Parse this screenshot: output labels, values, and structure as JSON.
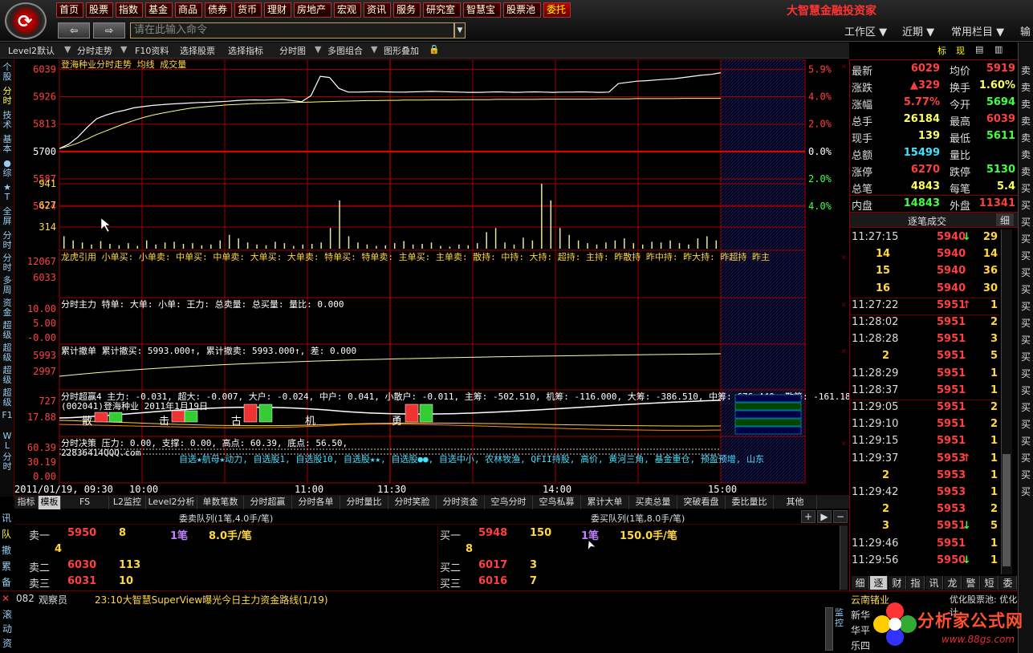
{
  "nav": {
    "items": [
      "首页",
      "股票",
      "指数",
      "基金",
      "商品",
      "债券",
      "货币",
      "理财",
      "房地产",
      "宏观",
      "资讯",
      "服务",
      "研究室",
      "智慧宝",
      "股票池",
      "委托"
    ],
    "selected": "委托",
    "brand": "大智慧金融投资家"
  },
  "command": {
    "placeholder": "请在此输入命令",
    "back": "⇦",
    "forward": "⇨"
  },
  "topright": {
    "workspace": "工作区 ▼",
    "recent": "近期 ▼",
    "common": "常用栏目 ▼",
    "extra": "输"
  },
  "toolbar": {
    "items": [
      "Level2默认",
      "分时走势",
      "F10资料",
      "选择股票",
      "选择指标",
      "分时图",
      "多图组合",
      "图形叠加"
    ],
    "right_items": [
      "标",
      "现"
    ]
  },
  "leftbar": {
    "items": [
      "个股",
      "分时",
      "技术",
      "基本",
      "●综",
      "★T",
      "全屏",
      "分时",
      "分时",
      "多周",
      "资金",
      "超级",
      "超级",
      "超级",
      "超级",
      "F1",
      "WL",
      "分时"
    ]
  },
  "chart": {
    "title": "登海种业分时走势  均线  成交量",
    "price_ticks": [
      "6039",
      "5926",
      "5813",
      "5700",
      "5587",
      "5474"
    ],
    "pct_ticks": [
      "5.9%",
      "4.0%",
      "2.0%",
      "0.0%",
      "2.0%",
      "4.0%"
    ],
    "vol_ticks": [
      "941",
      "627",
      "314"
    ],
    "indicator1": {
      "label": "龙虎引用  小单买: 小单卖: 中单买: 中单卖: 大单买: 大单卖: 特单买: 特单卖: 主单买: 主单卖: 散持: 中持: 大持: 超持: 主持: 昨散持  昨中持: 昨大持: 昨超持  昨主",
      "ticks": [
        "12067",
        "6033"
      ]
    },
    "indicator2": {
      "label": "分时主力  特单: 大单: 小单: 王力: 总卖量: 总买量: 量比: 0.000",
      "ticks": [
        "10.00",
        "5.00",
        "-0.00"
      ]
    },
    "indicator3": {
      "label": "累计撤单  累计撤买: 5993.000↑, 累计撤卖: 5993.000↑, 差: 0.000",
      "ticks": [
        "5993",
        "2997"
      ]
    },
    "indicator4": {
      "label": "分时超赢4  主力: -0.031, 超大: -0.007, 大户: -0.024, 中户: 0.041, 小散户: -0.011, 主筹: -502.510, 机筹: -116.000, 大筹: -386.510, 中筹: 676.440, 散筹: -161.180,",
      "sub": "(002041)登海种业  2011年1月19日",
      "ticks": [
        "727",
        "17.88"
      ],
      "overlay": [
        "散",
        "击",
        "古",
        "机",
        "勇"
      ]
    },
    "indicator5": {
      "label": "分时决策  压力: 0.00, 支撑: 0.00, 高点: 60.39, 底点: 56.50,",
      "sub": "22836414QQQ.com",
      "ticks": [
        "60.39",
        "30.19",
        "0.00"
      ]
    },
    "notice": "自选★航母★动力, 自选股1, 自选股10, 自选股★★, 自选股●●, 自选中小, 农林牧渔, QFII持股, 高价, 黄河三角, 基金重仓, 预盈预增, 山东",
    "time_ticks": [
      "2011/01/19, 09:30",
      "10:00",
      "11:00",
      "11:30",
      "14:00",
      "15:00"
    ],
    "price_series": [
      5712,
      5730,
      5760,
      5800,
      5835,
      5850,
      5862,
      5870,
      5880,
      5885,
      5890,
      5893,
      5896,
      5898,
      5900,
      5902,
      5903,
      5905,
      5907,
      5910,
      5912,
      5913,
      5912,
      5914,
      5915,
      5910,
      5905,
      5930,
      6010,
      6005,
      5960,
      5945,
      5945,
      5946,
      5947,
      5946,
      5945,
      5945,
      5946,
      5947,
      5948,
      5947,
      5946,
      5945,
      5944,
      5944,
      5945,
      5946,
      5945,
      5944,
      5945,
      5946,
      5945,
      5944,
      5945,
      5945,
      5946,
      5945,
      5944,
      5945,
      5980,
      5985,
      5990,
      5992,
      5995,
      5998,
      6000,
      6005,
      6010,
      6015,
      6018,
      6025
    ],
    "avg_series": [
      5712,
      5722,
      5735,
      5752,
      5770,
      5785,
      5800,
      5815,
      5828,
      5840,
      5850,
      5858,
      5865,
      5872,
      5878,
      5882,
      5886,
      5889,
      5892,
      5894,
      5896,
      5898,
      5899,
      5900,
      5901,
      5902,
      5903,
      5904,
      5905,
      5906,
      5907,
      5908,
      5909,
      5910,
      5910,
      5911,
      5911,
      5912,
      5912,
      5912,
      5913,
      5913,
      5913,
      5914,
      5914,
      5914,
      5914,
      5915,
      5915,
      5915,
      5915,
      5915,
      5916,
      5916,
      5916,
      5916,
      5916,
      5916,
      5917,
      5917,
      5917,
      5917,
      5918,
      5918,
      5918,
      5918,
      5918,
      5919,
      5919,
      5919,
      5919,
      5919
    ],
    "volume_series": [
      180,
      120,
      90,
      60,
      110,
      70,
      50,
      80,
      40,
      120,
      60,
      90,
      100,
      70,
      80,
      50,
      60,
      120,
      200,
      150,
      90,
      60,
      50,
      100,
      80,
      40,
      60,
      70,
      90,
      300,
      700,
      180,
      90,
      60,
      40,
      50,
      80,
      110,
      60,
      70,
      90,
      40,
      30,
      60,
      50,
      80,
      240,
      300,
      90,
      60,
      160,
      120,
      941,
      700,
      300,
      200,
      120,
      80,
      60,
      90,
      120,
      150,
      80,
      60,
      100,
      90,
      120,
      80,
      60,
      150,
      180,
      120
    ]
  },
  "bottom_tabs": {
    "items": [
      "指标",
      "模板",
      "FS",
      "L2监控",
      "Level2分析",
      "单数笔数",
      "分时超赢",
      "分时各单",
      "分时量比",
      "分时笑脸",
      "分时资金",
      "空鸟分时",
      "空鸟私募",
      "累计大单",
      "买卖总量",
      "突破看盘",
      "委比量比",
      "其他"
    ],
    "selected": "模板"
  },
  "queue": {
    "sell_title": "委卖队列(1笔,4.0手/笔)",
    "buy_title": "委买队列(1笔,8.0手/笔)",
    "side_tabs": [
      "讯",
      "队",
      "撤",
      "累",
      "备"
    ],
    "sell_rows": [
      {
        "label": "卖一",
        "price": "5950",
        "vol": "8",
        "count": "1笔",
        "avg": "8.0手/笔"
      },
      {
        "label": "",
        "price": "",
        "vol": "4",
        "count": "",
        "avg": ""
      },
      {
        "label": "卖二",
        "price": "6030",
        "vol": "113",
        "count": "",
        "avg": ""
      },
      {
        "label": "卖三",
        "price": "6031",
        "vol": "10",
        "count": "",
        "avg": ""
      }
    ],
    "buy_rows": [
      {
        "label": "买一",
        "price": "5948",
        "vol": "150",
        "count": "1笔",
        "avg": "150.0手/笔"
      },
      {
        "label": "",
        "price": "",
        "vol": "8",
        "count": "",
        "avg": ""
      },
      {
        "label": "买二",
        "price": "6017",
        "vol": "3",
        "count": "",
        "avg": ""
      },
      {
        "label": "买三",
        "price": "6016",
        "vol": "7",
        "count": "",
        "avg": ""
      }
    ],
    "buttons": [
      "+",
      "▶",
      "−"
    ]
  },
  "status": {
    "code": "082",
    "role": "观察员",
    "news": "23:10大智慧SuperView曝光今日主力资金路线(1/19)",
    "side_tabs": [
      "滚",
      "动",
      "资"
    ],
    "right_tabs": [
      "监",
      "控"
    ]
  },
  "quote": {
    "rows": [
      {
        "l1": "最新",
        "v1": "6029",
        "c1": "#ff4040",
        "l2": "均价",
        "v2": "5919",
        "c2": "#ff4040"
      },
      {
        "l1": "涨跌",
        "v1": "▲329",
        "c1": "#ff4040",
        "l2": "换手",
        "v2": "1.60%",
        "c2": "#ffff60"
      },
      {
        "l1": "涨幅",
        "v1": "5.77%",
        "c1": "#ff4040",
        "l2": "今开",
        "v2": "5694",
        "c2": "#40ff40"
      },
      {
        "l1": "总手",
        "v1": "26184",
        "c1": "#ffff60",
        "l2": "最高",
        "v2": "6039",
        "c2": "#ff4040"
      },
      {
        "l1": "现手",
        "v1": "139",
        "c1": "#ffff60",
        "l2": "最低",
        "v2": "5611",
        "c2": "#40ff40"
      },
      {
        "l1": "总额",
        "v1": "15499",
        "c1": "#40e0ff",
        "l2": "量比",
        "v2": "",
        "c2": "#ffff60"
      },
      {
        "l1": "涨停",
        "v1": "6270",
        "c1": "#ff4040",
        "l2": "跌停",
        "v2": "5130",
        "c2": "#40ff40"
      },
      {
        "l1": "总笔",
        "v1": "4843",
        "c1": "#ffff60",
        "l2": "每笔",
        "v2": "5.4",
        "c2": "#ffff60"
      },
      {
        "l1": "内盘",
        "v1": "14843",
        "c1": "#40ff40",
        "l2": "外盘",
        "v2": "11341",
        "c2": "#ff4040"
      }
    ],
    "ticks_title": "逐笔成交",
    "ticks_btn": "细",
    "ticks": [
      {
        "time": "11:27:15",
        "price": "5940",
        "arrow": "↓",
        "vol": "29",
        "color": "#ff4040",
        "acolor": "#40ff40"
      },
      {
        "time": "14",
        "price": "5940",
        "arrow": "",
        "vol": "14",
        "color": "#ff4040",
        "acolor": ""
      },
      {
        "time": "15",
        "price": "5940",
        "arrow": "",
        "vol": "36",
        "color": "#ff4040",
        "acolor": ""
      },
      {
        "time": "16",
        "price": "5940",
        "arrow": "",
        "vol": "30",
        "color": "#ff4040",
        "acolor": ""
      },
      {
        "time": "11:27:22",
        "price": "5951",
        "arrow": "↑",
        "vol": "1",
        "color": "#ff4040",
        "acolor": "#ff4040"
      },
      {
        "time": "11:28:02",
        "price": "5951",
        "arrow": "",
        "vol": "2",
        "color": "#ff4040",
        "acolor": ""
      },
      {
        "time": "11:28:28",
        "price": "5951",
        "arrow": "",
        "vol": "3",
        "color": "#ff4040",
        "acolor": ""
      },
      {
        "time": "2",
        "price": "5951",
        "arrow": "",
        "vol": "5",
        "color": "#ff4040",
        "acolor": ""
      },
      {
        "time": "11:28:29",
        "price": "5951",
        "arrow": "",
        "vol": "1",
        "color": "#ff4040",
        "acolor": ""
      },
      {
        "time": "11:28:37",
        "price": "5951",
        "arrow": "",
        "vol": "1",
        "color": "#ff4040",
        "acolor": ""
      },
      {
        "time": "11:29:05",
        "price": "5951",
        "arrow": "",
        "vol": "2",
        "color": "#ff4040",
        "acolor": ""
      },
      {
        "time": "11:29:10",
        "price": "5951",
        "arrow": "",
        "vol": "2",
        "color": "#ff4040",
        "acolor": ""
      },
      {
        "time": "11:29:15",
        "price": "5951",
        "arrow": "",
        "vol": "1",
        "color": "#ff4040",
        "acolor": ""
      },
      {
        "time": "11:29:37",
        "price": "5953",
        "arrow": "↑",
        "vol": "1",
        "color": "#ff4040",
        "acolor": "#ff4040"
      },
      {
        "time": "2",
        "price": "5953",
        "arrow": "",
        "vol": "1",
        "color": "#ff4040",
        "acolor": ""
      },
      {
        "time": "11:29:42",
        "price": "5953",
        "arrow": "",
        "vol": "1",
        "color": "#ff4040",
        "acolor": ""
      },
      {
        "time": "2",
        "price": "5953",
        "arrow": "",
        "vol": "2",
        "color": "#ff4040",
        "acolor": ""
      },
      {
        "time": "3",
        "price": "5951",
        "arrow": "↓",
        "vol": "5",
        "color": "#ff4040",
        "acolor": "#40ff40"
      },
      {
        "time": "11:29:46",
        "price": "5951",
        "arrow": "",
        "vol": "1",
        "color": "#ff4040",
        "acolor": ""
      },
      {
        "time": "11:29:56",
        "price": "5950",
        "arrow": "↓",
        "vol": "1",
        "color": "#ff4040",
        "acolor": "#40ff40"
      }
    ],
    "bottom_tabs": [
      "细",
      "逐",
      "财",
      "指",
      "讯",
      "龙",
      "警",
      "短",
      "委"
    ],
    "sector": "云南锗业",
    "pool": "优化股票池: 优化计",
    "news_tabs": [
      "新华",
      "华平",
      "乐四"
    ]
  },
  "farright": {
    "items": [
      "卖",
      "卖",
      "卖",
      "卖",
      "卖",
      "卖",
      "卖",
      "买",
      "买",
      "买",
      "买",
      "买",
      "买",
      "买",
      "买",
      "买",
      "买",
      "买",
      "买",
      "买",
      "买",
      "买",
      "买",
      "买",
      "买",
      "买"
    ]
  },
  "watermark": {
    "title": "分析家公式网",
    "url": "www.88gs.com"
  }
}
